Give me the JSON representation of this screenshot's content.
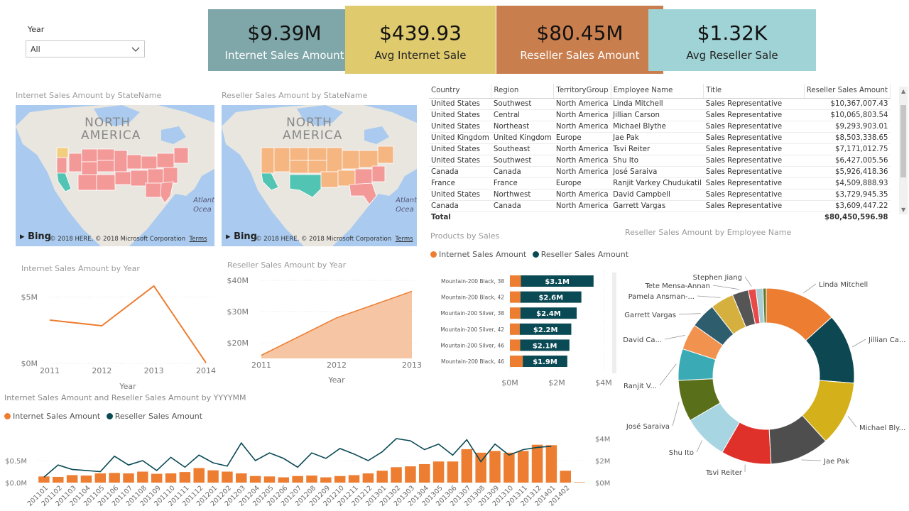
{
  "slicer": {
    "label": "Year",
    "value": "All"
  },
  "kpis": [
    {
      "value": "$9.39M",
      "label": "Internet Sales Amount",
      "color": "#7fa6a8"
    },
    {
      "value": "$439.93",
      "label": "Avg Internet Sale",
      "color": "#dfca6e"
    },
    {
      "value": "$80.45M",
      "label": "Reseller Sales Amount",
      "color": "#c97e4e"
    },
    {
      "value": "$1.32K",
      "label": "Avg Reseller Sale",
      "color": "#a0d3d6"
    }
  ],
  "maps": {
    "internet_title": "Internet Sales Amount by StateName",
    "reseller_title": "Reseller Sales Amount by StateName",
    "continent_line1": "NORTH",
    "continent_line2": "AMERICA",
    "ocean_line1": "Atlant",
    "ocean_line2": "Ocea",
    "bing": "Bing",
    "copyright": "© 2018 HERE, © 2018 Microsoft Corporation",
    "terms": "Terms"
  },
  "table": {
    "columns": [
      "Country",
      "Region",
      "TerritoryGroup",
      "Employee Name",
      "Title",
      "Reseller Sales Amount"
    ],
    "rows": [
      [
        "United States",
        "Southwest",
        "North America",
        "Linda Mitchell",
        "Sales Representative",
        "$10,367,007.43"
      ],
      [
        "United States",
        "Central",
        "North America",
        "Jillian Carson",
        "Sales Representative",
        "$10,065,803.54"
      ],
      [
        "United States",
        "Northeast",
        "North America",
        "Michael Blythe",
        "Sales Representative",
        "$9,293,903.01"
      ],
      [
        "United Kingdom",
        "United Kingdom",
        "Europe",
        "Jae Pak",
        "Sales Representative",
        "$8,503,338.65"
      ],
      [
        "United States",
        "Southeast",
        "North America",
        "Tsvi Reiter",
        "Sales Representative",
        "$7,171,012.75"
      ],
      [
        "United States",
        "Southwest",
        "North America",
        "Shu Ito",
        "Sales Representative",
        "$6,427,005.56"
      ],
      [
        "Canada",
        "Canada",
        "North America",
        "José Saraiva",
        "Sales Representative",
        "$5,926,418.36"
      ],
      [
        "France",
        "France",
        "Europe",
        "Ranjit Varkey Chudukatil",
        "Sales Representative",
        "$4,509,888.93"
      ],
      [
        "United States",
        "Northwest",
        "North America",
        "David Campbell",
        "Sales Representative",
        "$3,729,945.35"
      ],
      [
        "Canada",
        "Canada",
        "North America",
        "Garrett Vargas",
        "Sales Representative",
        "$3,609,447.22"
      ]
    ],
    "total_label": "Total",
    "total_value": "$80,450,596.98"
  },
  "colors": {
    "orange": "#ed7d31",
    "teal": "#0a4a55",
    "area": "#f5c09a"
  },
  "chart_data": [
    {
      "id": "internet_by_year",
      "type": "line",
      "title": "Internet Sales Amount by Year",
      "xlabel": "Year",
      "categories": [
        "2011",
        "2012",
        "2013",
        "2014"
      ],
      "values": [
        3.27,
        2.84,
        5.84,
        0.05
      ],
      "unit": "M",
      "ylim": [
        0,
        6
      ],
      "yticks": [
        "$0M",
        "$5M"
      ]
    },
    {
      "id": "reseller_by_year",
      "type": "area",
      "title": "Reseller Sales Amount by Year",
      "xlabel": "Year",
      "categories": [
        "2011",
        "2012",
        "2013"
      ],
      "values": [
        16,
        28,
        36.5
      ],
      "unit": "M",
      "ylim": [
        15,
        40
      ],
      "yticks": [
        "$20M",
        "$30M",
        "$40M"
      ]
    },
    {
      "id": "products_by_sales",
      "type": "bar",
      "title": "Products by Sales",
      "legend": [
        "Internet Sales Amount",
        "Reseller Sales Amount"
      ],
      "categories": [
        "Mountain-200 Black, 38",
        "Mountain-200 Black, 42",
        "Mountain-200 Silver, 38",
        "Mountain-200 Silver, 42",
        "Mountain-200 Silver, 46",
        "Mountain-200 Black, 46"
      ],
      "series": [
        {
          "name": "Internet Sales Amount",
          "values": [
            0.47,
            0.45,
            0.45,
            0.42,
            0.44,
            0.55
          ]
        },
        {
          "name": "Reseller Sales Amount",
          "values": [
            3.1,
            2.6,
            2.4,
            2.2,
            2.1,
            1.9
          ]
        }
      ],
      "data_labels": [
        "$3.1M",
        "$2.6M",
        "$2.4M",
        "$2.2M",
        "$2.1M",
        "$1.9M"
      ],
      "xticks": [
        "$0M",
        "$2M",
        "$4M"
      ],
      "xlim": [
        0,
        4
      ]
    },
    {
      "id": "reseller_by_employee",
      "type": "pie",
      "title": "Reseller Sales Amount by Employee Name",
      "labels": [
        "Linda Mitchell",
        "Jillian Ca...",
        "Michael Bly...",
        "Jae Pak",
        "Tsvi Reiter",
        "Shu Ito",
        "José Saraiva",
        "Ranjit V...",
        "David Ca...",
        "Garrett Vargas",
        "Pamela Ansman-...",
        "Tete Mensa-Annan",
        "Stephen Jiang",
        "",
        ""
      ],
      "values": [
        10.37,
        10.07,
        9.29,
        8.5,
        7.17,
        6.43,
        5.93,
        4.51,
        3.73,
        3.61,
        3.33,
        2.31,
        1.09,
        1.0,
        0.47
      ],
      "colors": [
        "#ed7d31",
        "#0d4852",
        "#d4b11a",
        "#4e4e4e",
        "#e0302a",
        "#a7d5e2",
        "#5a6f1a",
        "#3aaab5",
        "#f2924f",
        "#2e5e6e",
        "#d5b03e",
        "#555555",
        "#e84a4a",
        "#a9cfd5",
        "#5f7a2a"
      ]
    },
    {
      "id": "sales_by_yyyymm",
      "type": "bar",
      "title": "Internet Sales Amount and Reseller Sales Amount by YYYYMM",
      "legend": [
        "Internet Sales Amount",
        "Reseller Sales Amount"
      ],
      "categories": [
        "201101",
        "201102",
        "201103",
        "201104",
        "201105",
        "201106",
        "201107",
        "201108",
        "201109",
        "201110",
        "201111",
        "201112",
        "201201",
        "201202",
        "201203",
        "201204",
        "201205",
        "201206",
        "201207",
        "201208",
        "201209",
        "201210",
        "201211",
        "201212",
        "201301",
        "201302",
        "201303",
        "201304",
        "201305",
        "201306",
        "201307",
        "201308",
        "201309",
        "201310",
        "201311",
        "201312",
        "201401",
        "201402"
      ],
      "series": [
        {
          "name": "Internet Sales Amount",
          "axis": "left",
          "unit": "M",
          "values": [
            0.14,
            0.13,
            0.17,
            0.16,
            0.21,
            0.22,
            0.21,
            0.25,
            0.2,
            0.21,
            0.24,
            0.33,
            0.28,
            0.25,
            0.21,
            0.15,
            0.14,
            0.12,
            0.15,
            0.16,
            0.12,
            0.15,
            0.17,
            0.21,
            0.27,
            0.35,
            0.37,
            0.42,
            0.48,
            0.48,
            0.76,
            0.68,
            0.72,
            0.68,
            0.72,
            0.86,
            0.85,
            0.27,
            0.01
          ]
        },
        {
          "name": "Reseller Sales Amount",
          "axis": "right",
          "unit": "M",
          "values": [
            0.5,
            1.6,
            1.2,
            1.1,
            1.0,
            2.4,
            1.6,
            2.0,
            1.1,
            2.3,
            1.4,
            2.5,
            1.8,
            1.5,
            3.6,
            2.0,
            2.7,
            2.2,
            1.4,
            2.7,
            2.2,
            3.1,
            2.6,
            2.0,
            2.8,
            4.0,
            3.8,
            3.0,
            3.5,
            2.5,
            3.9,
            1.9,
            3.5,
            2.5,
            3.0,
            3.2,
            3.3
          ]
        }
      ],
      "yticks_left": [
        "$0.0M",
        "$0.5M"
      ],
      "yticks_right": [
        "$0M",
        "$2M",
        "$4M"
      ],
      "ylim_left": [
        0,
        1.0
      ],
      "ylim_right": [
        0,
        4.0
      ]
    }
  ]
}
